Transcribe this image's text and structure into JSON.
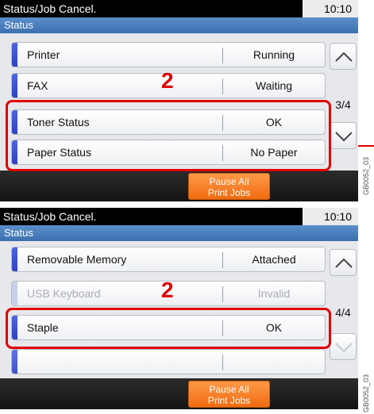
{
  "screens": [
    {
      "title": "Status/Job Cancel.",
      "time": "10:10",
      "section": "Status",
      "rows": [
        {
          "label": "Printer",
          "value": "Running"
        },
        {
          "label": "FAX",
          "value": "Waiting"
        },
        {
          "label": "Toner Status",
          "value": "OK"
        },
        {
          "label": "Paper Status",
          "value": "No Paper"
        }
      ],
      "page_indicator": "3/4",
      "pause_button": {
        "line1": "Pause All",
        "line2": "Print Jobs"
      },
      "step_number": "2",
      "side_code": "GB0052_03"
    },
    {
      "title": "Status/Job Cancel.",
      "time": "10:10",
      "section": "Status",
      "rows": [
        {
          "label": "Removable Memory",
          "value": "Attached"
        },
        {
          "label": "USB Keyboard",
          "value": "Invalid"
        },
        {
          "label": "Staple",
          "value": "OK"
        },
        {
          "label": "",
          "value": ""
        }
      ],
      "page_indicator": "4/4",
      "pause_button": {
        "line1": "Pause All",
        "line2": "Print Jobs"
      },
      "step_number": "2",
      "side_code": "GB0052_03"
    }
  ],
  "icons": {
    "up": "chevron-up-icon",
    "down": "chevron-down-icon"
  },
  "colors": {
    "highlight": "#e00000",
    "header": "#3c6fae",
    "pause_button": "#ef6b10"
  }
}
